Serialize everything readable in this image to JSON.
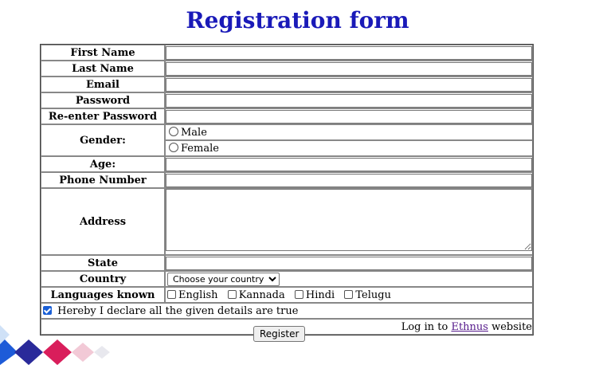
{
  "title": "Registration form",
  "labels": {
    "first_name": "First Name",
    "last_name": "Last Name",
    "email": "Email",
    "password": "Password",
    "reenter_password": "Re-enter Password",
    "gender": "Gender:",
    "age": "Age:",
    "phone": "Phone Number",
    "address": "Address",
    "state": "State",
    "country": "Country",
    "languages": "Languages known"
  },
  "gender_options": [
    "Male",
    "Female"
  ],
  "country_select": {
    "selected": "Choose your country"
  },
  "languages": [
    "English",
    "Kannada",
    "Hindi",
    "Telugu"
  ],
  "declaration": {
    "text": "Hereby I declare all the given details are true",
    "checked": true
  },
  "login": {
    "prefix": "Log in to ",
    "link": "Ethnus",
    "suffix": " website"
  },
  "register_label": "Register",
  "colors": {
    "title": "#1a1ab8",
    "checkbox_checked": "#1a5fd6",
    "visited_link": "#551a8b"
  }
}
